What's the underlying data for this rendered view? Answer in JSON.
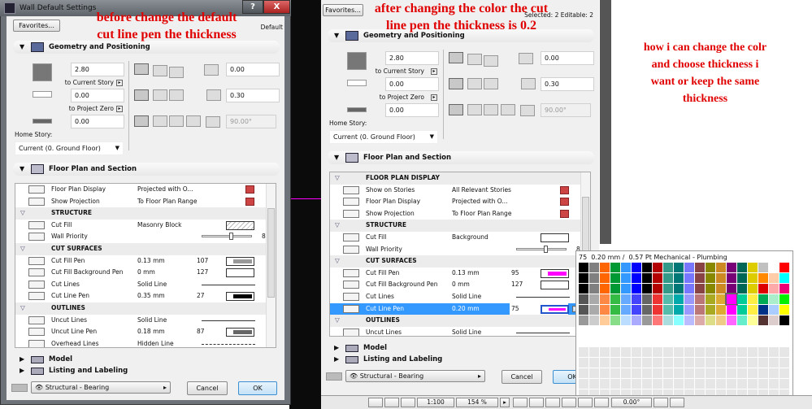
{
  "annotations": {
    "left": [
      "before change the default",
      "cut line pen the thickness"
    ],
    "right": [
      "after changing the color the cut",
      "line pen the thickness is 0.2"
    ],
    "question": [
      "how i can change the colr",
      "and choose thickness i",
      "want or keep the same",
      "thickness"
    ]
  },
  "left_dialog": {
    "title": "Wall Default Settings",
    "help": "?",
    "close": "X",
    "favorites": "Favorites...",
    "status": "Default",
    "geometry": {
      "header": "Geometry and Positioning",
      "top_height": "2.80",
      "top_link": "to Current Story",
      "bottom_offset": "0.00",
      "bottom_link": "to Project Zero",
      "base": "0.00",
      "home_story_label": "Home Story:",
      "home_story": "Current (0. Ground Floor)",
      "ref_offset": "0.00",
      "thickness": "0.30",
      "angle": "90.00°"
    },
    "floor_plan_header": "Floor Plan and Section",
    "rows": [
      {
        "type": "prop",
        "name": "Floor Plan Display",
        "value": "Projected with O...",
        "swatch": "icon"
      },
      {
        "type": "prop",
        "name": "Show Projection",
        "value": "To Floor Plan Range",
        "swatch": "icon"
      },
      {
        "type": "hdr",
        "name": "STRUCTURE"
      },
      {
        "type": "prop",
        "name": "Cut Fill",
        "value": "Masonry Block",
        "swatch": "hatch"
      },
      {
        "type": "prop",
        "name": "Wall Priority",
        "value": "",
        "num": "8",
        "swatch": "slider"
      },
      {
        "type": "hdr",
        "name": "CUT SURFACES"
      },
      {
        "type": "prop",
        "name": "Cut Fill Pen",
        "value": "0.13 mm",
        "num": "107",
        "swatch": "pen",
        "color": "#999999"
      },
      {
        "type": "prop",
        "name": "Cut Fill Background Pen",
        "value": "0 mm",
        "num": "127",
        "swatch": "empty"
      },
      {
        "type": "prop",
        "name": "Cut Lines",
        "value": "Solid Line",
        "swatch": "line"
      },
      {
        "type": "prop",
        "name": "Cut Line Pen",
        "value": "0.35 mm",
        "num": "27",
        "swatch": "pen",
        "color": "#000000"
      },
      {
        "type": "hdr",
        "name": "OUTLINES"
      },
      {
        "type": "prop",
        "name": "Uncut Lines",
        "value": "Solid Line",
        "swatch": "line"
      },
      {
        "type": "prop",
        "name": "Uncut Line Pen",
        "value": "0.18 mm",
        "num": "87",
        "swatch": "pen",
        "color": "#666666"
      },
      {
        "type": "prop",
        "name": "Overhead Lines",
        "value": "Hidden Line",
        "swatch": "dashed"
      }
    ],
    "model_header": "Model",
    "listing_header": "Listing and Labeling",
    "classification": "Structural - Bearing",
    "cancel": "Cancel",
    "ok": "OK"
  },
  "right_dialog": {
    "favorites": "Favorites...",
    "status": "Selected: 2 Editable: 2",
    "geometry": {
      "header": "Geometry and Positioning",
      "top_height": "2.80",
      "top_link": "to Current Story",
      "bottom_offset": "0.00",
      "bottom_link": "to Project Zero",
      "base": "0.00",
      "home_story_label": "Home Story:",
      "home_story": "Current (0. Ground Floor)",
      "ref_offset": "0.00",
      "thickness": "0.30",
      "angle": "90.00°"
    },
    "floor_plan_header": "Floor Plan and Section",
    "rows": [
      {
        "type": "hdr",
        "name": "FLOOR PLAN DISPLAY"
      },
      {
        "type": "prop",
        "name": "Show on Stories",
        "value": "All Relevant Stories",
        "swatch": "icon"
      },
      {
        "type": "prop",
        "name": "Floor Plan Display",
        "value": "Projected with O...",
        "swatch": "icon"
      },
      {
        "type": "prop",
        "name": "Show Projection",
        "value": "To Floor Plan Range",
        "swatch": "icon"
      },
      {
        "type": "hdr",
        "name": "STRUCTURE"
      },
      {
        "type": "prop",
        "name": "Cut Fill",
        "value": "Background",
        "swatch": "empty"
      },
      {
        "type": "prop",
        "name": "Wall Priority",
        "value": "",
        "num": "8",
        "swatch": "slider"
      },
      {
        "type": "hdr",
        "name": "CUT SURFACES"
      },
      {
        "type": "prop",
        "name": "Cut Fill Pen",
        "value": "0.13 mm",
        "num": "95",
        "swatch": "pen",
        "color": "#ff00ff"
      },
      {
        "type": "prop",
        "name": "Cut Fill Background Pen",
        "value": "0 mm",
        "num": "127",
        "swatch": "empty"
      },
      {
        "type": "prop",
        "name": "Cut Lines",
        "value": "Solid Line",
        "swatch": "line"
      },
      {
        "type": "prop",
        "name": "Cut Line Pen",
        "value": "0.20 mm",
        "num": "75",
        "swatch": "pen",
        "color": "#ff00ff",
        "selected": true
      },
      {
        "type": "hdr",
        "name": "OUTLINES"
      },
      {
        "type": "prop",
        "name": "Uncut Lines",
        "value": "Solid Line",
        "swatch": "line"
      }
    ],
    "model_header": "Model",
    "listing_header": "Listing and Labeling",
    "classification": "Structural - Bearing",
    "cancel": "Cancel",
    "ok": "OK"
  },
  "palette": {
    "header": "75  0.20 mm /  0.57 Pt Mechanical - Plumbing",
    "selected": [
      3,
      14
    ],
    "rows": [
      [
        "#000000",
        "#808080",
        "#ff6600",
        "#009933",
        "#3399ff",
        "#0000ff",
        "#000000",
        "#b30000",
        "#339988",
        "#007777",
        "#7777ff",
        "#884444",
        "#888800",
        "#cc8822",
        "#770077",
        "#006655",
        "#ddcc00",
        "#c0c0c0",
        "#ffffff",
        "#ff0000"
      ],
      [
        "#000000",
        "#808080",
        "#ff6600",
        "#009933",
        "#3399ff",
        "#0000ff",
        "#000000",
        "#b30000",
        "#339988",
        "#007777",
        "#7777ff",
        "#884444",
        "#888800",
        "#cc8822",
        "#770077",
        "#006655",
        "#ddcc00",
        "#ff8800",
        "#ffccaa",
        "#00ffff"
      ],
      [
        "#000000",
        "#808080",
        "#ff6600",
        "#009933",
        "#3399ff",
        "#0000ff",
        "#000000",
        "#b30000",
        "#339988",
        "#007777",
        "#7777ff",
        "#884444",
        "#888800",
        "#cc8822",
        "#770077",
        "#006655",
        "#ddcc00",
        "#dd0000",
        "#ffaaaa",
        "#ee0077"
      ],
      [
        "#555555",
        "#aaaaaa",
        "#ff8844",
        "#33bb44",
        "#66aaff",
        "#4444ff",
        "#666666",
        "#ee3333",
        "#55bbaa",
        "#00aaaa",
        "#9999ff",
        "#bb7777",
        "#aaaa22",
        "#ddaa33",
        "#ff00ff",
        "#00cc99",
        "#ffee44",
        "#00aa55",
        "#aaeecc",
        "#00ee00"
      ],
      [
        "#555555",
        "#aaaaaa",
        "#ff8844",
        "#33bb44",
        "#66aaff",
        "#4444ff",
        "#666666",
        "#ee3333",
        "#55bbaa",
        "#00aaaa",
        "#9999ff",
        "#bb7777",
        "#aaaa22",
        "#ddaa33",
        "#ff00ff",
        "#00cc99",
        "#ffee44",
        "#003388",
        "#aaccff",
        "#ffff00"
      ],
      [
        "#999999",
        "#cccccc",
        "#ffcc99",
        "#88dd88",
        "#bbddff",
        "#aaaaff",
        "#999999",
        "#ff7777",
        "#aadddd",
        "#88ffff",
        "#bbbbff",
        "#ddaaaa",
        "#dddd88",
        "#eecc88",
        "#ff66ff",
        "#66eecc",
        "#ffff99",
        "#553333",
        "#ddcccc",
        "#000000"
      ]
    ],
    "empty_rows": 5
  },
  "statusbar": {
    "scale": "1:100",
    "zoom": "154 %",
    "angle": "0.00°"
  },
  "colors": {
    "accent": "#3399ff",
    "annotation": "#e00000",
    "pen_magenta": "#ff00ff"
  }
}
